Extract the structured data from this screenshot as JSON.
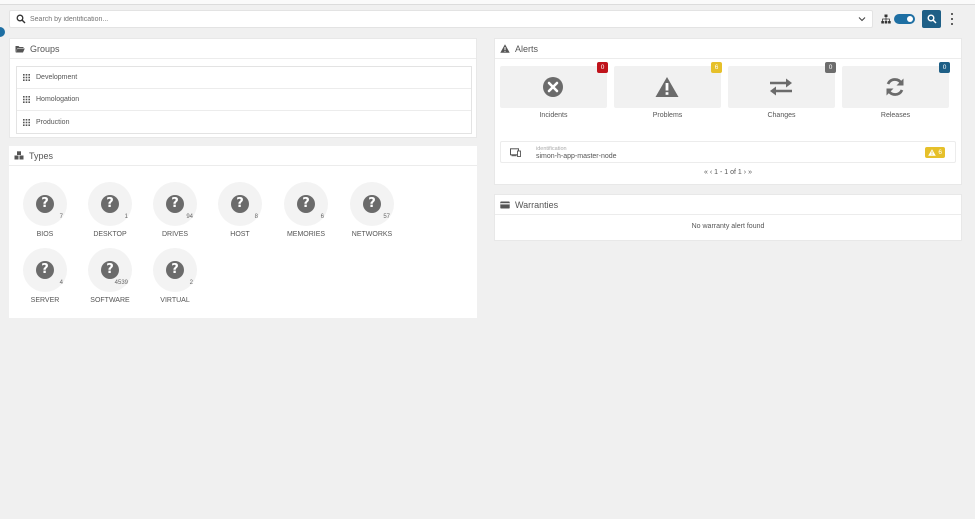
{
  "search": {
    "placeholder": "Search by identification..."
  },
  "groups": {
    "title": "Groups",
    "items": [
      {
        "label": "Development"
      },
      {
        "label": "Homologation"
      },
      {
        "label": "Production"
      }
    ]
  },
  "types": {
    "title": "Types",
    "items": [
      {
        "label": "BIOS",
        "count": "7"
      },
      {
        "label": "DESKTOP",
        "count": "1"
      },
      {
        "label": "DRIVES",
        "count": "94"
      },
      {
        "label": "HOST",
        "count": "8"
      },
      {
        "label": "MEMORIES",
        "count": "6"
      },
      {
        "label": "NETWORKS",
        "count": "57"
      },
      {
        "label": "SERVER",
        "count": "4"
      },
      {
        "label": "SOFTWARE",
        "count": "4539"
      },
      {
        "label": "VIRTUAL",
        "count": "2"
      }
    ]
  },
  "alerts": {
    "title": "Alerts",
    "boxes": [
      {
        "label": "Incidents",
        "count": "0",
        "color": "#c0131b",
        "icon": "times-circle-icon"
      },
      {
        "label": "Problems",
        "count": "6",
        "color": "#e6c02a",
        "icon": "warning-icon"
      },
      {
        "label": "Changes",
        "count": "0",
        "color": "#6d6d6d",
        "icon": "exchange-icon"
      },
      {
        "label": "Releases",
        "count": "0",
        "color": "#1e5f86",
        "icon": "refresh-icon"
      }
    ],
    "row": {
      "field_label": "identification",
      "value": "simon-h-app-master-node",
      "badge": "6"
    },
    "pager": {
      "first": "«",
      "prev": "‹",
      "text": "1 - 1 of 1",
      "next": "›",
      "last": "»"
    }
  },
  "warranties": {
    "title": "Warranties",
    "message": "No warranty alert found"
  }
}
